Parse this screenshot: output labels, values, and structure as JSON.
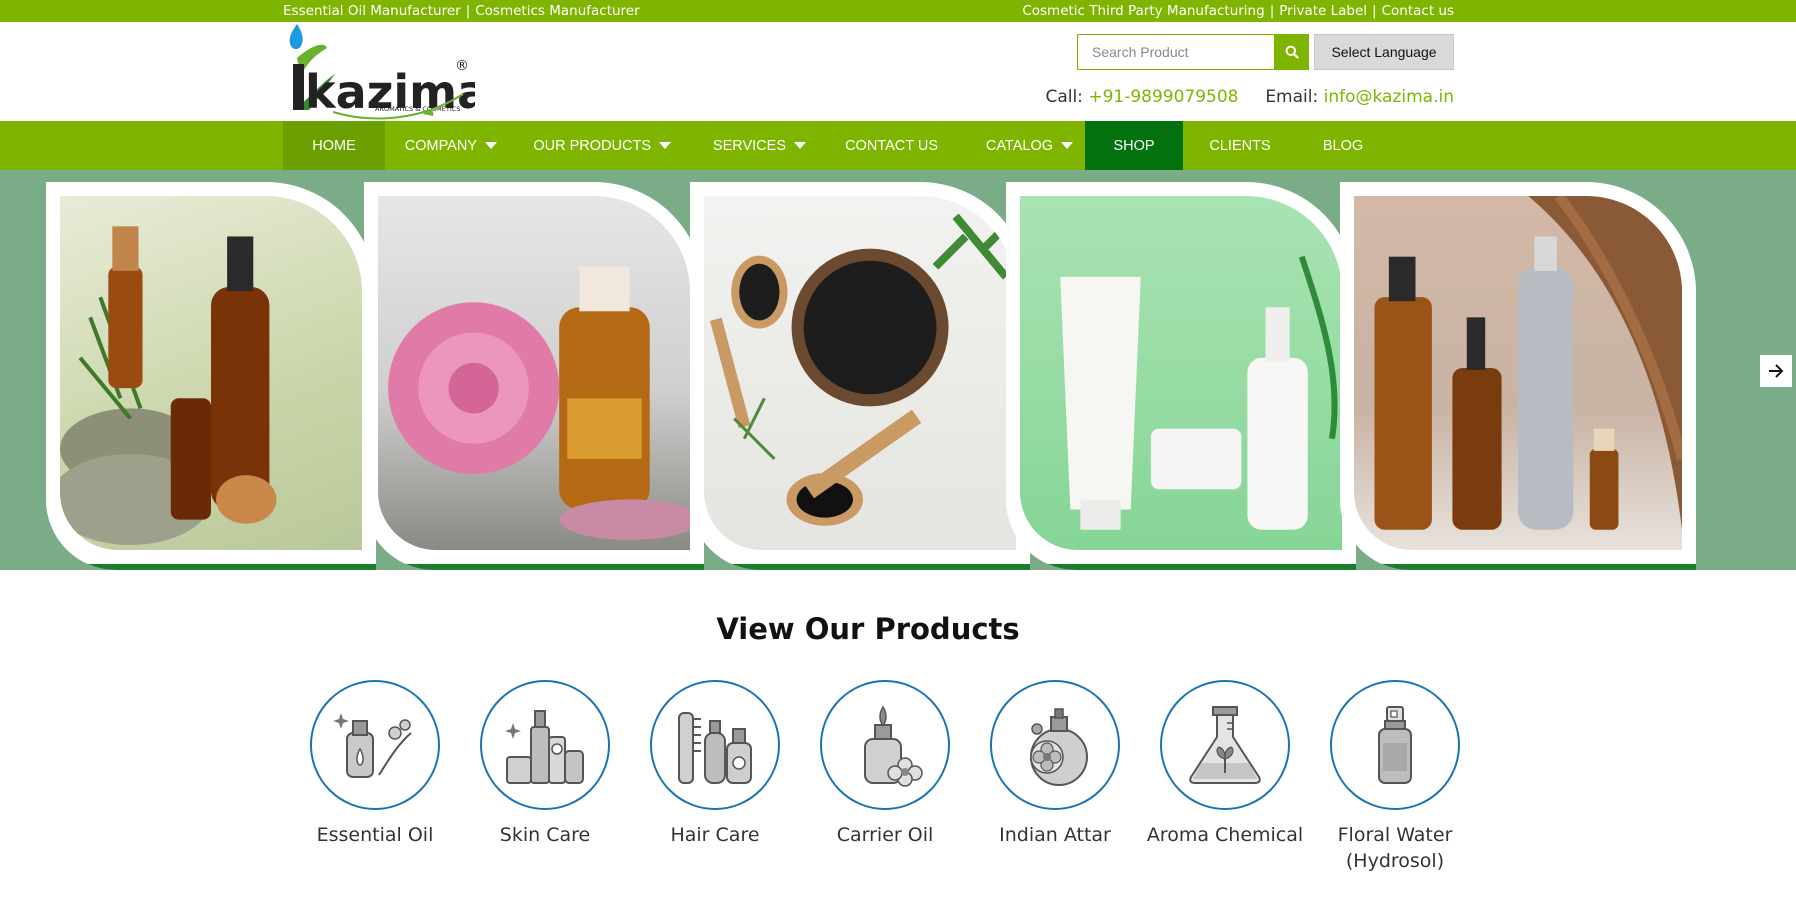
{
  "topbar": {
    "left_1": "Essential Oil Manufacturer",
    "left_2": "Cosmetics Manufacturer",
    "right_1": "Cosmetic Third Party Manufacturing",
    "right_2": "Private Label",
    "right_3": "Contact us",
    "separator": "|"
  },
  "header": {
    "logo_text": "kazima",
    "logo_tagline": "AROMATICS & COSMETICS",
    "logo_registered": "®",
    "search_placeholder": "Search Product",
    "language_button": "Select Language",
    "call_label": "Call:",
    "call_number": "+91-9899079508",
    "email_label": "Email:",
    "email_address": "info@kazima.in"
  },
  "nav": {
    "items": [
      {
        "label": "HOME",
        "dropdown": false
      },
      {
        "label": "COMPANY",
        "dropdown": true
      },
      {
        "label": "OUR PRODUCTS",
        "dropdown": true
      },
      {
        "label": "SERVICES",
        "dropdown": true
      },
      {
        "label": "CONTACT US",
        "dropdown": false
      },
      {
        "label": "CATALOG",
        "dropdown": true
      },
      {
        "label": "SHOP",
        "dropdown": false
      },
      {
        "label": "CLIENTS",
        "dropdown": false
      },
      {
        "label": "BLOG",
        "dropdown": false
      }
    ]
  },
  "slider": {
    "slides": [
      "essential-oil-bottles",
      "rose-and-oil",
      "herbal-scrub",
      "white-cosmetic-tubes",
      "hair-care-bottles"
    ],
    "next_icon": "arrow-right-icon"
  },
  "products_section": {
    "title": "View Our Products",
    "items": [
      {
        "label": "Essential Oil",
        "icon": "essential-oil-icon"
      },
      {
        "label": "Skin Care",
        "icon": "skin-care-icon"
      },
      {
        "label": "Hair Care",
        "icon": "hair-care-icon"
      },
      {
        "label": "Carrier Oil",
        "icon": "carrier-oil-icon"
      },
      {
        "label": "Indian Attar",
        "icon": "indian-attar-icon"
      },
      {
        "label": "Aroma Chemical",
        "icon": "aroma-chemical-icon"
      },
      {
        "label": "Floral Water (Hydrosol)",
        "icon": "floral-water-icon"
      }
    ]
  },
  "colors": {
    "brand_green": "#7fb500",
    "shop_green": "#04720e",
    "slider_bg": "#7aac88",
    "icon_ring": "#1a74b4"
  }
}
